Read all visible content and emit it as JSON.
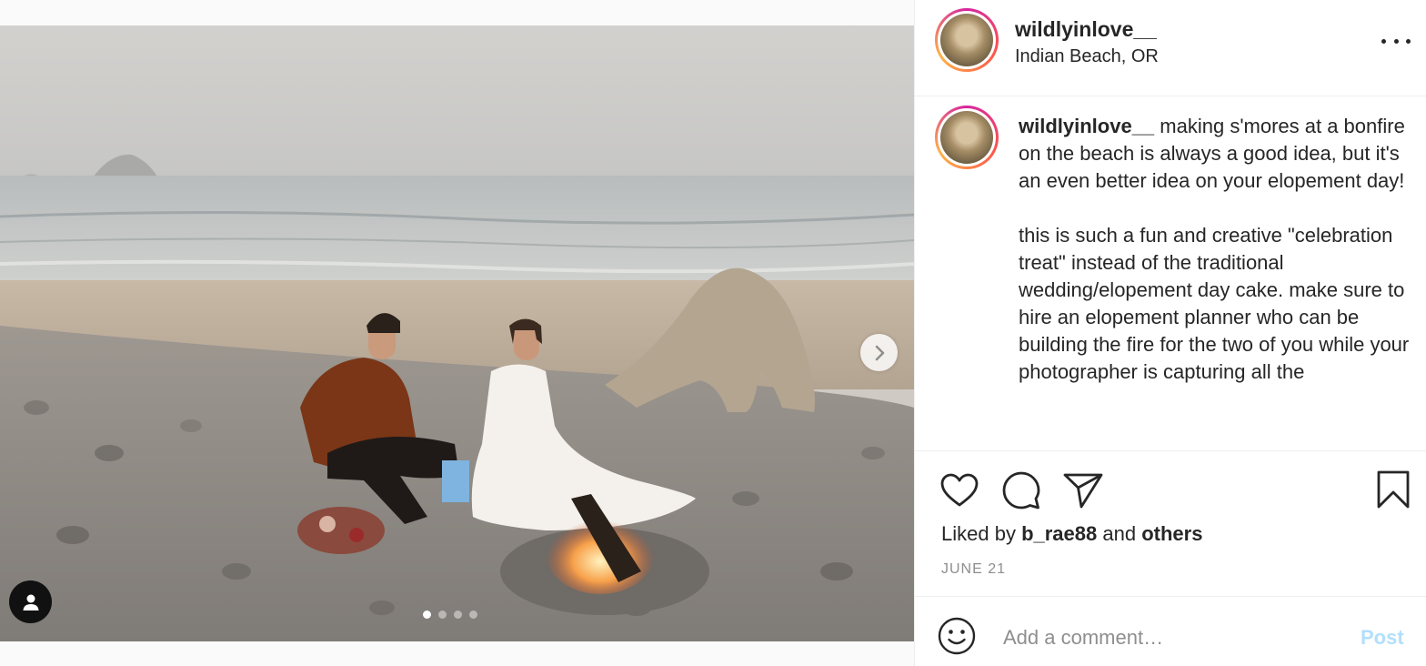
{
  "post": {
    "image_alt_icons": {
      "next": "chevron-right-icon",
      "tag": "user-icon"
    },
    "carousel": {
      "count": 4,
      "active_index": 0
    }
  },
  "header": {
    "username": "wildlyinlove__",
    "location": "Indian Beach, OR",
    "more_icon": "more-horizontal-icon"
  },
  "caption": {
    "username": "wildlyinlove__",
    "paragraph1": " making s'mores at a bonfire on the beach is always a good idea, but it's an even better idea on your elopement day!",
    "paragraph2": "this is such a fun and creative \"celebration treat\" instead of the traditional wedding/elopement day cake. make sure to hire an elopement planner who can be building the fire for the two of you while your photographer is capturing all the"
  },
  "actions": {
    "like_icon": "heart-icon",
    "comment_icon": "comment-icon",
    "share_icon": "send-icon",
    "save_icon": "bookmark-icon",
    "liked_by_prefix": "Liked by ",
    "liked_by_user": "b_rae88",
    "liked_by_and": " and ",
    "liked_by_others": "others",
    "date": "JUNE 21"
  },
  "comment": {
    "placeholder": "Add a comment…",
    "post_label": "Post",
    "emoji_icon": "smiley-icon"
  },
  "colors": {
    "post_button_disabled": "#b2dffc",
    "text_primary": "#262626",
    "text_secondary": "#8e8e8e",
    "divider": "#efefef"
  }
}
